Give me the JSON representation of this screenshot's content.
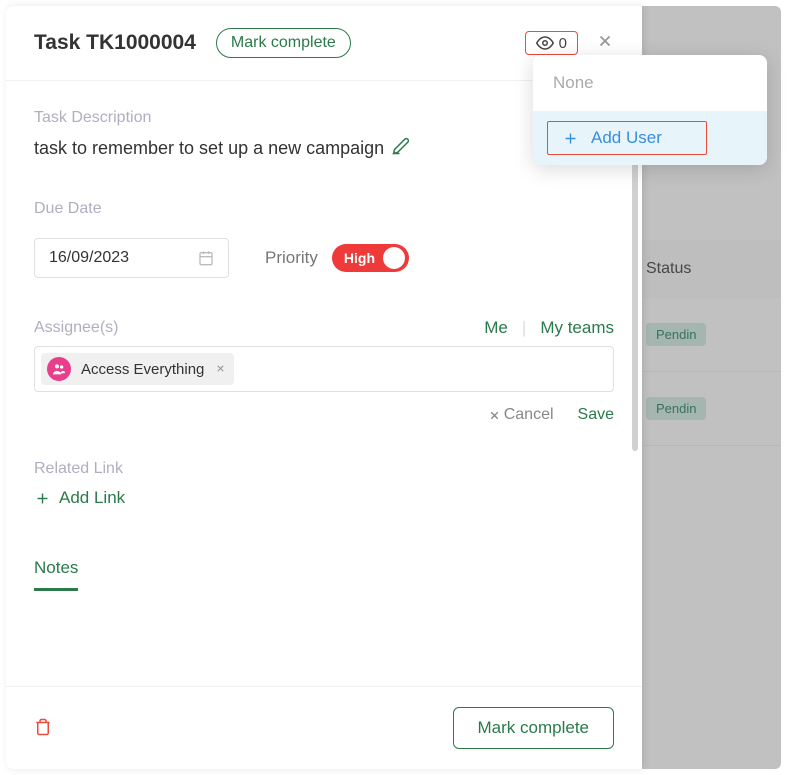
{
  "header": {
    "task_title": "Task TK1000004",
    "mark_complete_label": "Mark complete",
    "watch_count": "0"
  },
  "description": {
    "label": "Task Description",
    "text": "task to remember to set up a new campaign"
  },
  "due_date": {
    "label": "Due Date",
    "value": "16/09/2023"
  },
  "priority": {
    "label": "Priority",
    "value": "High"
  },
  "assignee": {
    "label": "Assignee(s)",
    "me_label": "Me",
    "my_teams_label": "My teams",
    "chips": [
      {
        "name": "Access Everything"
      }
    ],
    "cancel_label": "Cancel",
    "save_label": "Save"
  },
  "related_link": {
    "label": "Related Link",
    "add_label": "Add Link"
  },
  "notes": {
    "tab_label": "Notes"
  },
  "footer": {
    "mark_complete_label": "Mark complete"
  },
  "dropdown": {
    "none_label": "None",
    "add_user_label": "Add User"
  },
  "background": {
    "status_header": "Status",
    "rows": [
      {
        "badge": "Pendin"
      },
      {
        "badge": "Pendin"
      }
    ]
  }
}
